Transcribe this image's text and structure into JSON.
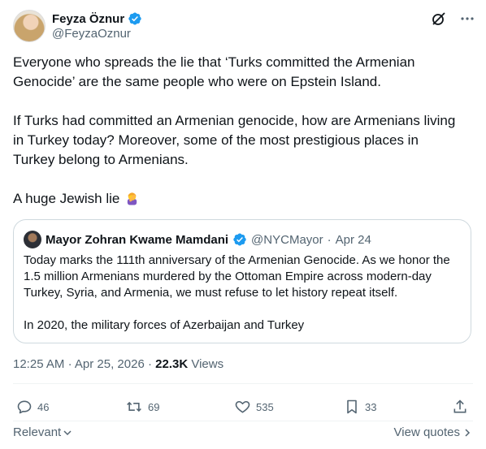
{
  "author": {
    "name": "Feyza Öznur",
    "handle": "@FeyzaOznur"
  },
  "tweet": {
    "line1": "Everyone who spreads the lie that ‘Turks committed the Armenian",
    "line2": "Genocide’ are the same people who were on Epstein Island.",
    "line3": "If Turks had committed an Armenian genocide, how are Armenians living",
    "line4": "in Turkey today? Moreover, some of the most prestigious places in",
    "line5": "Turkey belong to Armenians.",
    "line6": "A huge Jewish lie",
    "emoji": "person-facepalming"
  },
  "quote": {
    "name": "Mayor Zohran Kwame Mamdani",
    "handle": "@NYCMayor",
    "separator": "·",
    "date": "Apr 24",
    "line1": "Today marks the 111th anniversary of the Armenian Genocide. As we honor the",
    "line2": "1.5 million Armenians murdered by the Ottoman Empire across modern-day",
    "line3": "Turkey, Syria, and Armenia, we must refuse to let history repeat itself.",
    "line4": "In 2020, the military forces of Azerbaijan and Turkey"
  },
  "meta": {
    "time": "12:25 AM",
    "separator1": "·",
    "date": "Apr 25, 2026",
    "separator2": "·",
    "views_count": "22.3K",
    "views_label": "Views"
  },
  "actions": {
    "replies": "46",
    "reposts": "69",
    "likes": "535",
    "bookmarks": "33"
  },
  "footer": {
    "sort_label": "Relevant",
    "view_quotes_label": "View quotes"
  },
  "colors": {
    "text": "#0f1419",
    "secondary": "#536471",
    "verified": "#1d9bf0",
    "border": "#cfd9de"
  }
}
